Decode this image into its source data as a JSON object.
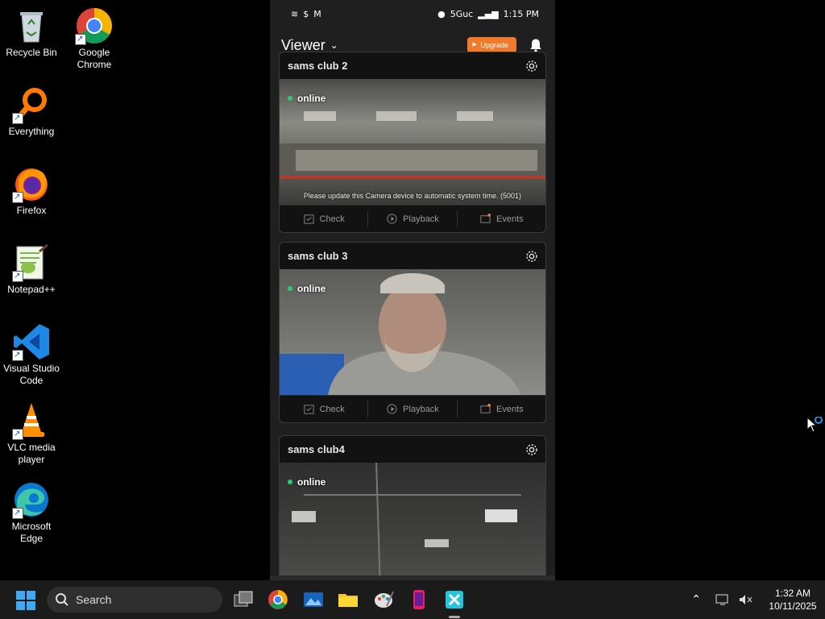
{
  "desktop": {
    "icons": [
      {
        "label": "Recycle Bin",
        "icon": "recycle-bin-icon"
      },
      {
        "label": "Google Chrome",
        "icon": "chrome-icon"
      },
      {
        "label": "Everything",
        "icon": "everything-search-icon"
      },
      {
        "label": "Firefox",
        "icon": "firefox-icon"
      },
      {
        "label": "Notepad++",
        "icon": "notepadpp-icon"
      },
      {
        "label": "Visual Studio Code",
        "icon": "vscode-icon"
      },
      {
        "label": "VLC media player",
        "icon": "vlc-icon"
      },
      {
        "label": "Microsoft Edge",
        "icon": "edge-icon"
      }
    ]
  },
  "phone": {
    "status": {
      "network": "5Guc",
      "time": "1:15 PM"
    },
    "header": {
      "title": "Viewer",
      "upgrade_label": "Upgrade"
    },
    "cameras": [
      {
        "name": "sams club 2",
        "status": "online",
        "notice": "Please update this Camera device to automatic system time. (5001)"
      },
      {
        "name": "sams club 3",
        "status": "online",
        "notice": ""
      },
      {
        "name": "sams club4",
        "status": "online",
        "notice": ""
      }
    ],
    "actions": {
      "check": "Check",
      "playback": "Playback",
      "events": "Events"
    }
  },
  "taskbar": {
    "search_label": "Search",
    "time": "1:32 AM",
    "date": "10/11/2025"
  },
  "colors": {
    "accent_orange": "#f07a2a",
    "online_green": "#2ecc71",
    "windows_blue": "#3fa9f5"
  }
}
